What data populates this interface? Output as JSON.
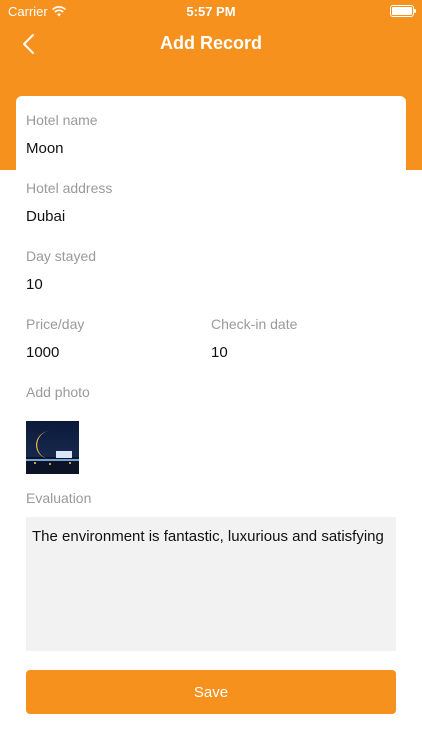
{
  "status_bar": {
    "carrier": "Carrier",
    "time": "5:57 PM"
  },
  "nav": {
    "title": "Add Record",
    "back_icon": "chevron-left-icon"
  },
  "form": {
    "hotel_name": {
      "label": "Hotel name",
      "value": "Moon"
    },
    "hotel_address": {
      "label": "Hotel address",
      "value": "Dubai"
    },
    "day_stayed": {
      "label": "Day stayed",
      "value": "10"
    },
    "price_day": {
      "label": "Price/day",
      "value": "1000"
    },
    "checkin_date": {
      "label": "Check-in date",
      "value": "10"
    },
    "add_photo": {
      "label": "Add photo"
    },
    "evaluation": {
      "label": "Evaluation",
      "value": "The environment is fantastic, luxurious and satisfying"
    }
  },
  "save_label": "Save",
  "colors": {
    "accent": "#F7911E",
    "background": "#FFFFFF",
    "label": "#9A9A9A",
    "text": "#111111",
    "input_bg": "#F2F2F2"
  }
}
